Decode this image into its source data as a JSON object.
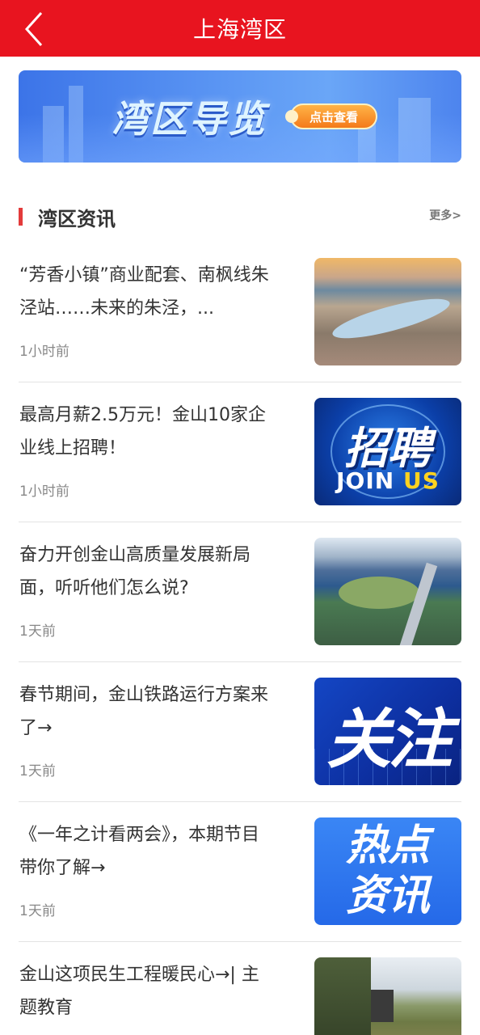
{
  "header": {
    "title": "上海湾区",
    "back_icon": "chevron-left-icon"
  },
  "banner": {
    "title": "湾区导览",
    "button_label": "点击查看"
  },
  "section": {
    "title": "湾区资讯",
    "more_label": "更多>"
  },
  "colors": {
    "brand_red": "#e8141f",
    "section_bar": "#e33b3b",
    "banner_blue": "#4d84ee"
  },
  "news": [
    {
      "title": "“芳香小镇”商业配套、南枫线朱泾站……未来的朱泾，...",
      "time": "1小时前",
      "thumb": "aerial-town-photo"
    },
    {
      "title": "最高月薪2.5万元！金山10家企业线上招聘！",
      "time": "1小时前",
      "thumb": "recruitment-graphic",
      "thumb_text": "招聘",
      "thumb_sub_a": "JOIN ",
      "thumb_sub_b": "US"
    },
    {
      "title": "奋力开创金山高质量发展新局面，听听他们怎么说?",
      "time": "1天前",
      "thumb": "aerial-lake-photo"
    },
    {
      "title": "春节期间，金山铁路运行方案来了→",
      "time": "1天前",
      "thumb": "focus-graphic",
      "thumb_text": "关注"
    },
    {
      "title": "《一年之计看两会》，本期节目带你了解→",
      "time": "1天前",
      "thumb": "hot-news-graphic",
      "thumb_text_1": "热点",
      "thumb_text_2": "资讯"
    },
    {
      "title": "金山这项民生工程暖民心→| 主题教育",
      "time": "",
      "thumb": "construction-field-photo"
    }
  ]
}
